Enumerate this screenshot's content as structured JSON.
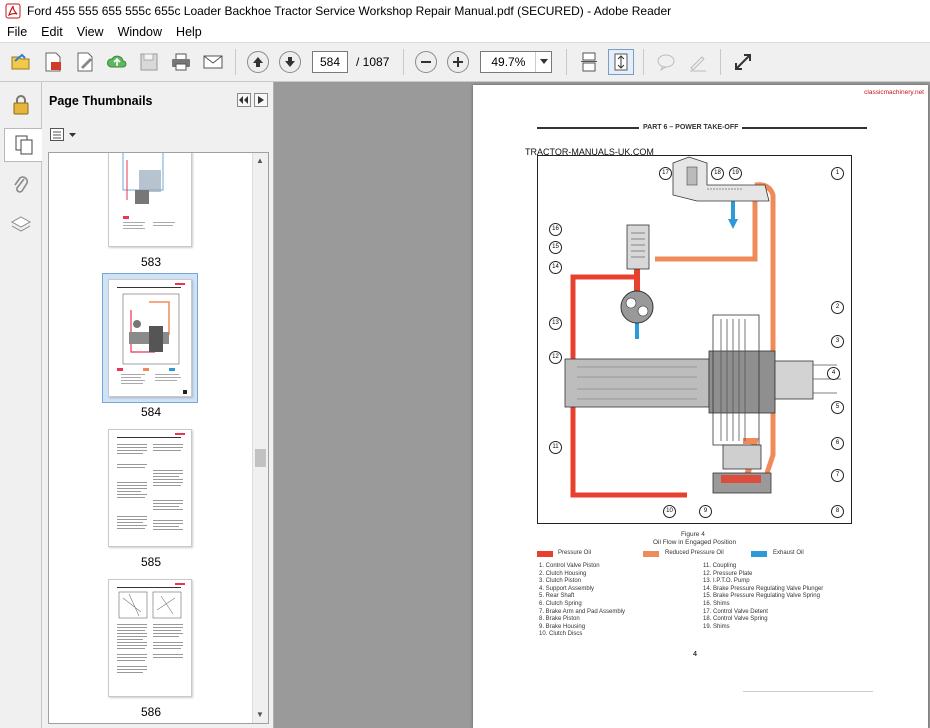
{
  "window": {
    "title": "Ford 455 555 655 555c 655c Loader Backhoe Tractor Service  Workshop  Repair Manual.pdf (SECURED) - Adobe Reader"
  },
  "menu": {
    "items": [
      "File",
      "Edit",
      "View",
      "Window",
      "Help"
    ]
  },
  "toolbar": {
    "current_page": "584",
    "total_pages": "/ 1087",
    "zoom": "49.7%"
  },
  "sidebar": {
    "panel_title": "Page Thumbnails",
    "thumbnails": [
      {
        "label": "583"
      },
      {
        "label": "584"
      },
      {
        "label": "585"
      },
      {
        "label": "586"
      }
    ]
  },
  "document": {
    "watermark_corner": "classicmachinery.net",
    "section_header": "PART 6 – POWER TAKE-OFF",
    "site_watermark": "TRACTOR-MANUALS-UK.COM",
    "figure_title": "Figure 4",
    "figure_caption": "Oil Flow in Engaged Position",
    "legend": {
      "pressure": "Pressure Oil",
      "reduced": "Reduced Pressure Oil",
      "exhaust": "Exhaust Oil"
    },
    "parts_left": [
      "1.   Control Valve Piston",
      "2.   Clutch Housing",
      "3.   Clutch Piston",
      "4.   Support Assembly",
      "5.   Rear Shaft",
      "6.   Clutch Spring",
      "7.   Brake Arm and Pad Assembly",
      "8.   Brake Piston",
      "9.   Brake Housing",
      "10.  Clutch Discs"
    ],
    "parts_right": [
      "11.  Coupling",
      "12.  Pressure Plate",
      "13.  I.P.T.O. Pump",
      "14.  Brake Pressure Regulating Valve Plunger",
      "15.  Brake Pressure Regulating Valve Spring",
      "16.  Shims",
      "17.  Control Valve Detent",
      "18.  Control Valve Spring",
      "19.  Shims"
    ],
    "page_number": "4",
    "callouts": [
      "1",
      "2",
      "3",
      "4",
      "5",
      "6",
      "7",
      "8",
      "9",
      "10",
      "11",
      "12",
      "13",
      "14",
      "15",
      "16",
      "17",
      "18",
      "19"
    ]
  },
  "colors": {
    "pressure_oil": "#e8402e",
    "reduced_pressure_oil": "#ef8a5a",
    "exhaust_oil": "#2d9ad8",
    "selection": "#cfe3f7"
  }
}
